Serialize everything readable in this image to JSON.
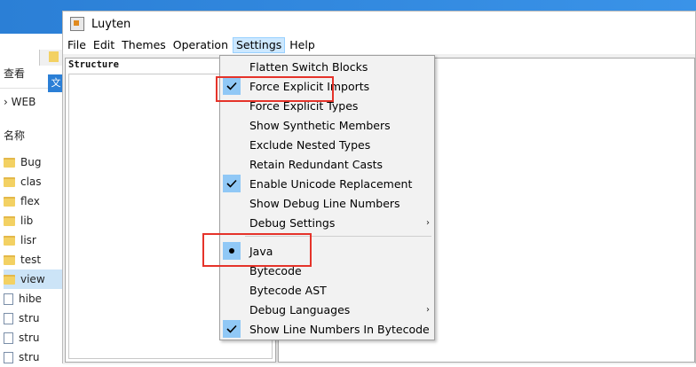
{
  "window": {
    "title": "Luyten"
  },
  "menubar": [
    {
      "label": "File"
    },
    {
      "label": "Edit"
    },
    {
      "label": "Themes"
    },
    {
      "label": "Operation"
    },
    {
      "label": "Settings"
    },
    {
      "label": "Help"
    }
  ],
  "structure": {
    "label": "Structure"
  },
  "settings_menu": {
    "items": [
      {
        "label": "Flatten Switch Blocks",
        "checked": false
      },
      {
        "label": "Force Explicit Imports",
        "checked": true
      },
      {
        "label": "Force Explicit Types",
        "checked": false
      },
      {
        "label": "Show Synthetic Members",
        "checked": false
      },
      {
        "label": "Exclude Nested Types",
        "checked": false
      },
      {
        "label": "Retain Redundant Casts",
        "checked": false
      },
      {
        "label": "Enable Unicode Replacement",
        "checked": true
      },
      {
        "label": "Show Debug Line Numbers",
        "checked": false
      },
      {
        "label": "Debug Settings",
        "submenu": true
      },
      {
        "label": "Java",
        "selected": true
      },
      {
        "label": "Bytecode"
      },
      {
        "label": "Bytecode AST"
      },
      {
        "label": "Debug Languages",
        "submenu": true
      },
      {
        "label": "Show Line Numbers In Bytecode",
        "checked": true
      }
    ]
  },
  "explorer": {
    "view_label": "查看",
    "path_label": "WEB",
    "name_header": "名称",
    "menu_fragment": "文",
    "files": [
      {
        "name": "Bug",
        "type": "folder"
      },
      {
        "name": "clas",
        "type": "folder"
      },
      {
        "name": "flex",
        "type": "folder"
      },
      {
        "name": "lib",
        "type": "folder"
      },
      {
        "name": "lisr",
        "type": "folder"
      },
      {
        "name": "test",
        "type": "folder"
      },
      {
        "name": "view",
        "type": "folder",
        "selected": true
      },
      {
        "name": "hibe",
        "type": "file"
      },
      {
        "name": "stru",
        "type": "file"
      },
      {
        "name": "stru",
        "type": "file"
      },
      {
        "name": "stru",
        "type": "file"
      }
    ]
  },
  "colors": {
    "accent": "#90c8f6",
    "highlight": "#e5332a",
    "title_blue": "#2b7fd6"
  }
}
